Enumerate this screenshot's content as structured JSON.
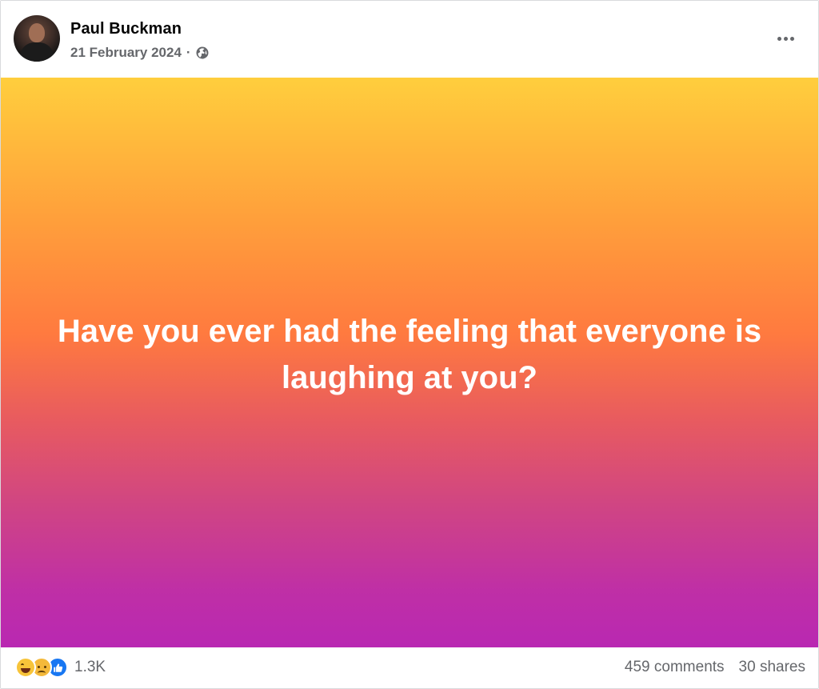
{
  "author": {
    "name": "Paul Buckman",
    "date": "21 February 2024",
    "separator": "·",
    "audience_icon": "globe-icon",
    "avatar_icon": "avatar"
  },
  "header": {
    "more_icon": "more-options-icon"
  },
  "post": {
    "text": "Have you ever had the feeling that everyone is laughing at you?",
    "background_gradient": [
      "#ffce3d",
      "#ff7a3f",
      "#b928b2"
    ],
    "text_color": "#ffffff"
  },
  "footer": {
    "reaction_icons": [
      "haha-icon",
      "sad-icon",
      "like-icon"
    ],
    "reaction_count": "1.3K",
    "comments": "459 comments",
    "shares": "30 shares"
  },
  "colors": {
    "like_blue": "#1877f2",
    "secondary_text": "#65676b",
    "primary_text": "#050505"
  }
}
